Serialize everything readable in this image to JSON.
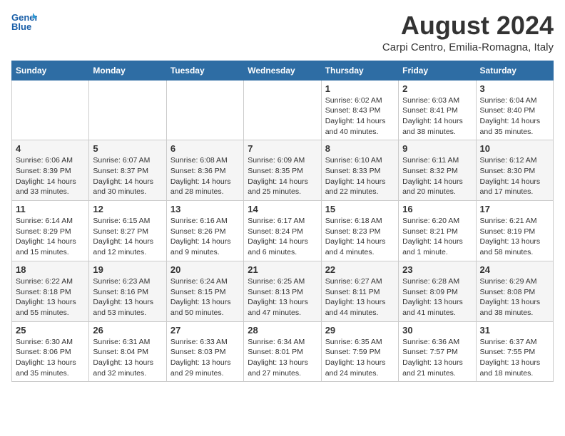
{
  "header": {
    "logo_line1": "General",
    "logo_line2": "Blue",
    "month_year": "August 2024",
    "location": "Carpi Centro, Emilia-Romagna, Italy"
  },
  "weekdays": [
    "Sunday",
    "Monday",
    "Tuesday",
    "Wednesday",
    "Thursday",
    "Friday",
    "Saturday"
  ],
  "weeks": [
    [
      {
        "day": "",
        "info": ""
      },
      {
        "day": "",
        "info": ""
      },
      {
        "day": "",
        "info": ""
      },
      {
        "day": "",
        "info": ""
      },
      {
        "day": "1",
        "info": "Sunrise: 6:02 AM\nSunset: 8:43 PM\nDaylight: 14 hours\nand 40 minutes."
      },
      {
        "day": "2",
        "info": "Sunrise: 6:03 AM\nSunset: 8:41 PM\nDaylight: 14 hours\nand 38 minutes."
      },
      {
        "day": "3",
        "info": "Sunrise: 6:04 AM\nSunset: 8:40 PM\nDaylight: 14 hours\nand 35 minutes."
      }
    ],
    [
      {
        "day": "4",
        "info": "Sunrise: 6:06 AM\nSunset: 8:39 PM\nDaylight: 14 hours\nand 33 minutes."
      },
      {
        "day": "5",
        "info": "Sunrise: 6:07 AM\nSunset: 8:37 PM\nDaylight: 14 hours\nand 30 minutes."
      },
      {
        "day": "6",
        "info": "Sunrise: 6:08 AM\nSunset: 8:36 PM\nDaylight: 14 hours\nand 28 minutes."
      },
      {
        "day": "7",
        "info": "Sunrise: 6:09 AM\nSunset: 8:35 PM\nDaylight: 14 hours\nand 25 minutes."
      },
      {
        "day": "8",
        "info": "Sunrise: 6:10 AM\nSunset: 8:33 PM\nDaylight: 14 hours\nand 22 minutes."
      },
      {
        "day": "9",
        "info": "Sunrise: 6:11 AM\nSunset: 8:32 PM\nDaylight: 14 hours\nand 20 minutes."
      },
      {
        "day": "10",
        "info": "Sunrise: 6:12 AM\nSunset: 8:30 PM\nDaylight: 14 hours\nand 17 minutes."
      }
    ],
    [
      {
        "day": "11",
        "info": "Sunrise: 6:14 AM\nSunset: 8:29 PM\nDaylight: 14 hours\nand 15 minutes."
      },
      {
        "day": "12",
        "info": "Sunrise: 6:15 AM\nSunset: 8:27 PM\nDaylight: 14 hours\nand 12 minutes."
      },
      {
        "day": "13",
        "info": "Sunrise: 6:16 AM\nSunset: 8:26 PM\nDaylight: 14 hours\nand 9 minutes."
      },
      {
        "day": "14",
        "info": "Sunrise: 6:17 AM\nSunset: 8:24 PM\nDaylight: 14 hours\nand 6 minutes."
      },
      {
        "day": "15",
        "info": "Sunrise: 6:18 AM\nSunset: 8:23 PM\nDaylight: 14 hours\nand 4 minutes."
      },
      {
        "day": "16",
        "info": "Sunrise: 6:20 AM\nSunset: 8:21 PM\nDaylight: 14 hours\nand 1 minute."
      },
      {
        "day": "17",
        "info": "Sunrise: 6:21 AM\nSunset: 8:19 PM\nDaylight: 13 hours\nand 58 minutes."
      }
    ],
    [
      {
        "day": "18",
        "info": "Sunrise: 6:22 AM\nSunset: 8:18 PM\nDaylight: 13 hours\nand 55 minutes."
      },
      {
        "day": "19",
        "info": "Sunrise: 6:23 AM\nSunset: 8:16 PM\nDaylight: 13 hours\nand 53 minutes."
      },
      {
        "day": "20",
        "info": "Sunrise: 6:24 AM\nSunset: 8:15 PM\nDaylight: 13 hours\nand 50 minutes."
      },
      {
        "day": "21",
        "info": "Sunrise: 6:25 AM\nSunset: 8:13 PM\nDaylight: 13 hours\nand 47 minutes."
      },
      {
        "day": "22",
        "info": "Sunrise: 6:27 AM\nSunset: 8:11 PM\nDaylight: 13 hours\nand 44 minutes."
      },
      {
        "day": "23",
        "info": "Sunrise: 6:28 AM\nSunset: 8:09 PM\nDaylight: 13 hours\nand 41 minutes."
      },
      {
        "day": "24",
        "info": "Sunrise: 6:29 AM\nSunset: 8:08 PM\nDaylight: 13 hours\nand 38 minutes."
      }
    ],
    [
      {
        "day": "25",
        "info": "Sunrise: 6:30 AM\nSunset: 8:06 PM\nDaylight: 13 hours\nand 35 minutes."
      },
      {
        "day": "26",
        "info": "Sunrise: 6:31 AM\nSunset: 8:04 PM\nDaylight: 13 hours\nand 32 minutes."
      },
      {
        "day": "27",
        "info": "Sunrise: 6:33 AM\nSunset: 8:03 PM\nDaylight: 13 hours\nand 29 minutes."
      },
      {
        "day": "28",
        "info": "Sunrise: 6:34 AM\nSunset: 8:01 PM\nDaylight: 13 hours\nand 27 minutes."
      },
      {
        "day": "29",
        "info": "Sunrise: 6:35 AM\nSunset: 7:59 PM\nDaylight: 13 hours\nand 24 minutes."
      },
      {
        "day": "30",
        "info": "Sunrise: 6:36 AM\nSunset: 7:57 PM\nDaylight: 13 hours\nand 21 minutes."
      },
      {
        "day": "31",
        "info": "Sunrise: 6:37 AM\nSunset: 7:55 PM\nDaylight: 13 hours\nand 18 minutes."
      }
    ]
  ]
}
